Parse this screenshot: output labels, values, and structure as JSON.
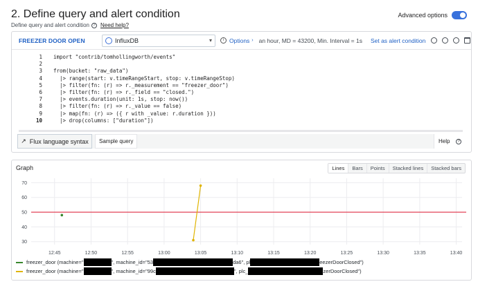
{
  "header": {
    "title": "2. Define query and alert condition",
    "subtitle": "Define query and alert condition",
    "help_link": "Need help?",
    "advanced_label": "Advanced options",
    "advanced_enabled": true
  },
  "query": {
    "name": "FREEZER DOOR OPEN",
    "datasource": "InfluxDB",
    "options_label": "Options",
    "options_text": "an hour, MD = 43200, Min. Interval = 1s",
    "alert_condition_label": "Set as alert condition",
    "code_lines": [
      "import \"contrib/tomhollingworth/events\"",
      "",
      "from(bucket: \"raw_data\")",
      "  |> range(start: v.timeRangeStart, stop: v.timeRangeStop)",
      "  |> filter(fn: (r) => r._measurement == \"freezer_door\")",
      "  |> filter(fn: (r) => r._field == \"closed.\")",
      "  |> events.duration(unit: 1s, stop: now())",
      "  |> filter(fn: (r) => r._value == false)",
      "  |> map(fn: (r) => ({ r with _value: r.duration }))",
      "  |> drop(columns: [\"duration\"])"
    ],
    "line_numbers": [
      "1",
      "2",
      "3",
      "4",
      "5",
      "6",
      "7",
      "8",
      "9",
      "10"
    ],
    "footer": {
      "flux_syntax_label": "Flux language syntax",
      "sample_query_label": "Sample query",
      "help_label": "Help"
    }
  },
  "graph": {
    "title": "Graph",
    "view_options": [
      "Lines",
      "Bars",
      "Points",
      "Stacked lines",
      "Stacked bars"
    ],
    "active_view": "Lines",
    "legend": [
      {
        "color": "#37872d",
        "parts": [
          "freezer_door (machine=\"",
          "\", machine_id=\"53",
          "da6\", pl",
          "eezerDoorClosed\")"
        ]
      },
      {
        "color": "#e0b400",
        "parts": [
          "freezer_door (machine=\"",
          "\", machine_id=\"99c",
          "\", plc_",
          "zerDoorClosed\")"
        ]
      }
    ]
  },
  "chart_data": {
    "type": "line",
    "x_ticks": [
      "12:45",
      "12:50",
      "12:55",
      "13:00",
      "13:05",
      "13:10",
      "13:15",
      "13:20",
      "13:25",
      "13:30",
      "13:35",
      "13:40"
    ],
    "y_ticks": [
      30,
      40,
      50,
      60,
      70
    ],
    "ylim": [
      28,
      73
    ],
    "threshold": {
      "value": 50,
      "color": "#e02f44"
    },
    "series": [
      {
        "color": "#37872d",
        "points": [
          [
            "12:46",
            48
          ]
        ]
      },
      {
        "color": "#e0b400",
        "points": [
          [
            "13:04",
            31
          ],
          [
            "13:05",
            68
          ]
        ]
      }
    ]
  }
}
